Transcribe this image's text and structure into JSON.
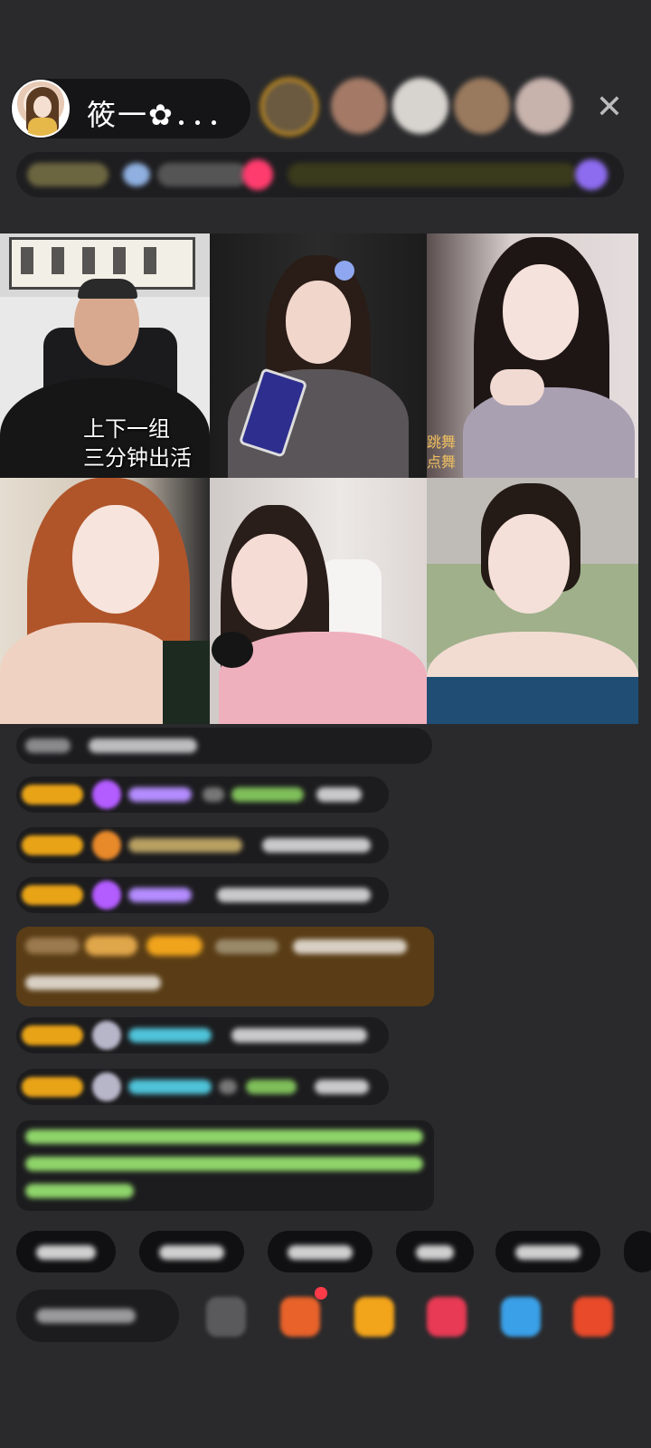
{
  "host": {
    "name": "筱一✿．．．"
  },
  "grid": {
    "tile1_caption_line1": "上下一组",
    "tile1_caption_line2": "三分钟出活",
    "tile3_side_text_line1": "跳舞",
    "tile3_side_text_line2": "点舞"
  },
  "icons": {
    "close": "close-icon",
    "emoji": "emoji-icon"
  },
  "colors": {
    "background": "#2a2a2c",
    "badge": "#e8a317",
    "chat_name_purple": "#b48cff",
    "chat_name_teal": "#4fc3d9",
    "chat_highlight": "#5a3d16",
    "notice_text": "#8fd46a"
  }
}
